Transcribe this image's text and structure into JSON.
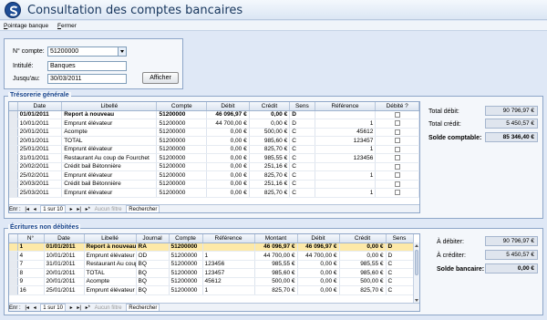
{
  "app": {
    "title": "Consultation des comptes bancaires"
  },
  "menu": {
    "pointage_prefix": "P",
    "pointage_rest": "ointage banque",
    "fermer_prefix": "F",
    "fermer_rest": "ermer"
  },
  "filters": {
    "account_label": "N° compte:",
    "account_value": "51200000",
    "intitule_label": "Intitulé:",
    "intitule_value": "Banques",
    "jusquau_label": "Jusqu'au:",
    "jusquau_value": "30/03/2011",
    "afficher_label": "Afficher"
  },
  "tresorerie": {
    "title": "Trésorerie générale",
    "columns": [
      "Date",
      "Libellé",
      "Compte",
      "Débit",
      "Crédit",
      "Sens",
      "Référence",
      "Débité ?"
    ],
    "rows": [
      {
        "date": "01/01/2011",
        "libelle": "Report à nouveau",
        "compte": "51200000",
        "debit": "46 096,97 €",
        "credit": "0,00 €",
        "sens": "D",
        "reference": "",
        "bold": true
      },
      {
        "date": "10/01/2011",
        "libelle": "Emprunt élévateur",
        "compte": "51200000",
        "debit": "44 700,00 €",
        "credit": "0,00 €",
        "sens": "D",
        "reference": "1",
        "bold": false
      },
      {
        "date": "20/01/2011",
        "libelle": "Acompte",
        "compte": "51200000",
        "debit": "0,00 €",
        "credit": "500,00 €",
        "sens": "C",
        "reference": "45612",
        "bold": false
      },
      {
        "date": "20/01/2011",
        "libelle": "TOTAL",
        "compte": "51200000",
        "debit": "0,00 €",
        "credit": "985,60 €",
        "sens": "C",
        "reference": "123457",
        "bold": false
      },
      {
        "date": "25/01/2011",
        "libelle": "Emprunt élévateur",
        "compte": "51200000",
        "debit": "0,00 €",
        "credit": "825,70 €",
        "sens": "C",
        "reference": "1",
        "bold": false
      },
      {
        "date": "31/01/2011",
        "libelle": "Restaurant Au coup de Fourchet",
        "compte": "51200000",
        "debit": "0,00 €",
        "credit": "985,55 €",
        "sens": "C",
        "reference": "123456",
        "bold": false
      },
      {
        "date": "20/02/2011",
        "libelle": "Crédit bail Bétonnière",
        "compte": "51200000",
        "debit": "0,00 €",
        "credit": "251,16 €",
        "sens": "C",
        "reference": "",
        "bold": false
      },
      {
        "date": "25/02/2011",
        "libelle": "Emprunt élévateur",
        "compte": "51200000",
        "debit": "0,00 €",
        "credit": "825,70 €",
        "sens": "C",
        "reference": "1",
        "bold": false
      },
      {
        "date": "20/03/2011",
        "libelle": "Crédit bail Bétonnière",
        "compte": "51200000",
        "debit": "0,00 €",
        "credit": "251,16 €",
        "sens": "C",
        "reference": "",
        "bold": false
      },
      {
        "date": "25/03/2011",
        "libelle": "Emprunt élévateur",
        "compte": "51200000",
        "debit": "0,00 €",
        "credit": "825,70 €",
        "sens": "C",
        "reference": "1",
        "bold": false
      }
    ],
    "nav": {
      "prefix": "Enr :",
      "position": "1 sur 10",
      "filter": "Aucun filtre",
      "search": "Rechercher"
    }
  },
  "totals_top": {
    "debit_label": "Total débit:",
    "debit_value": "90 796,97 €",
    "credit_label": "Total crédit:",
    "credit_value": "5 450,57 €",
    "solde_label": "Solde comptable:",
    "solde_value": "85 346,40 €"
  },
  "ecritures": {
    "title": "Écritures non débitées",
    "columns": [
      "N°",
      "Date",
      "Libellé",
      "Journal",
      "Compte",
      "Référence",
      "Montant",
      "Débit",
      "Crédit",
      "Sens"
    ],
    "rows": [
      {
        "n": "1",
        "date": "01/01/2011",
        "libelle": "Report à nouveau",
        "journal": "RA",
        "compte": "51200000",
        "reference": "",
        "montant": "46 096,97 €",
        "debit": "46 096,97 €",
        "credit": "0,00 €",
        "sens": "D",
        "bold": true,
        "active": true
      },
      {
        "n": "4",
        "date": "10/01/2011",
        "libelle": "Emprunt élévateur",
        "journal": "OD",
        "compte": "51200000",
        "reference": "1",
        "montant": "44 700,00 €",
        "debit": "44 700,00 €",
        "credit": "0,00 €",
        "sens": "D",
        "bold": false,
        "active": false
      },
      {
        "n": "7",
        "date": "31/01/2011",
        "libelle": "Restaurant Au coup",
        "journal": "BQ",
        "compte": "51200000",
        "reference": "123456",
        "montant": "985,55 €",
        "debit": "0,00 €",
        "credit": "985,55 €",
        "sens": "C",
        "bold": false,
        "active": false
      },
      {
        "n": "8",
        "date": "20/01/2011",
        "libelle": "TOTAL",
        "journal": "BQ",
        "compte": "51200000",
        "reference": "123457",
        "montant": "985,60 €",
        "debit": "0,00 €",
        "credit": "985,60 €",
        "sens": "C",
        "bold": false,
        "active": false
      },
      {
        "n": "9",
        "date": "20/01/2011",
        "libelle": "Acompte",
        "journal": "BQ",
        "compte": "51200000",
        "reference": "45612",
        "montant": "500,00 €",
        "debit": "0,00 €",
        "credit": "500,00 €",
        "sens": "C",
        "bold": false,
        "active": false
      },
      {
        "n": "16",
        "date": "25/01/2011",
        "libelle": "Emprunt élévateur",
        "journal": "BQ",
        "compte": "51200000",
        "reference": "1",
        "montant": "825,70 €",
        "debit": "0,00 €",
        "credit": "825,70 €",
        "sens": "C",
        "bold": false,
        "active": false
      }
    ],
    "nav": {
      "prefix": "Enr :",
      "position": "1 sur 10",
      "filter": "Aucun filtre",
      "search": "Rechercher"
    }
  },
  "totals_bottom": {
    "adebiter_label": "À débiter:",
    "adebiter_value": "90 796,97 €",
    "acrediter_label": "À créditer:",
    "acrediter_value": "5 450,57 €",
    "solde_label": "Solde bancaire:",
    "solde_value": "0,00 €"
  }
}
